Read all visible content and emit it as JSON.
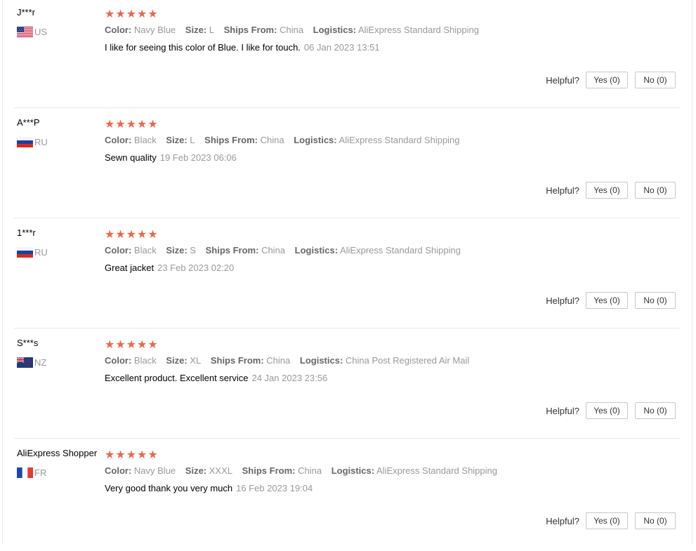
{
  "labels": {
    "color": "Color:",
    "size": "Size:",
    "ships_from": "Ships From:",
    "logistics": "Logistics:",
    "helpful": "Helpful?"
  },
  "colors": {
    "star": "#e0403a",
    "divider": "#e8e8e8"
  },
  "reviews": [
    {
      "user": "J***r",
      "country": "US",
      "flag": "us-flag-icon",
      "stars": "★★★★★",
      "color": "Navy Blue",
      "size": "L",
      "ships_from": "China",
      "logistics": "AliExpress Standard Shipping",
      "comment": "I like for seeing this color of Blue. I like for touch.",
      "date": "06 Jan 2023 13:51",
      "yes": "Yes (0)",
      "no": "No (0)"
    },
    {
      "user": "A***P",
      "country": "RU",
      "flag": "ru-flag-icon",
      "stars": "★★★★★",
      "color": "Black",
      "size": "L",
      "ships_from": "China",
      "logistics": "AliExpress Standard Shipping",
      "comment": "Sewn quality",
      "date": "19 Feb 2023 06:06",
      "yes": "Yes (0)",
      "no": "No (0)"
    },
    {
      "user": "1***r",
      "country": "RU",
      "flag": "ru-flag-icon",
      "stars": "★★★★★",
      "color": "Black",
      "size": "S",
      "ships_from": "China",
      "logistics": "AliExpress Standard Shipping",
      "comment": "Great jacket",
      "date": "23 Feb 2023 02:20",
      "yes": "Yes (0)",
      "no": "No (0)"
    },
    {
      "user": "S***s",
      "country": "NZ",
      "flag": "nz-flag-icon",
      "stars": "★★★★★",
      "color": "Black",
      "size": "XL",
      "ships_from": "China",
      "logistics": "China Post Registered Air Mail",
      "comment": "Excellent product. Excellent service",
      "date": "24 Jan 2023 23:56",
      "yes": "Yes (0)",
      "no": "No (0)"
    },
    {
      "user": "AliExpress Shopper",
      "country": "FR",
      "flag": "fr-flag-icon",
      "stars": "★★★★★",
      "color": "Navy Blue",
      "size": "XXXL",
      "ships_from": "China",
      "logistics": "AliExpress Standard Shipping",
      "comment": "Very good thank you very much",
      "date": "16 Feb 2023 19:04",
      "yes": "Yes (0)",
      "no": "No (0)"
    }
  ]
}
